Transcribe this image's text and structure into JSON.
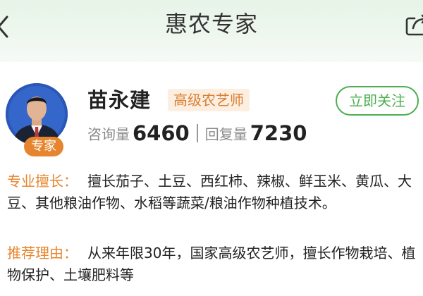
{
  "header": {
    "title": "惠农专家",
    "back_icon": "chevron-left-icon",
    "share_icon": "share-icon"
  },
  "expert": {
    "badge": "专家",
    "name": "苗永建",
    "title_tag": "高级农艺师",
    "follow_label": "立即关注",
    "stats": {
      "consult_label": "咨询量",
      "consult_value": "6460",
      "reply_label": "回复量",
      "reply_value": "7230"
    }
  },
  "specialty": {
    "label": "专业擅长：",
    "text": "擅长茄子、土豆、西红柿、辣椒、鲜玉米、黄瓜、大豆、其他粮油作物、水稻等蔬菜/粮油作物种植技术。"
  },
  "reason": {
    "label": "推荐理由：",
    "text": "从来年限30年，国家高级农艺师，擅长作物栽培、植物保护、土壤肥料等"
  },
  "colors": {
    "accent_orange": "#e7852f",
    "accent_green": "#4caf50",
    "header_bg": "#e7f4e8"
  }
}
